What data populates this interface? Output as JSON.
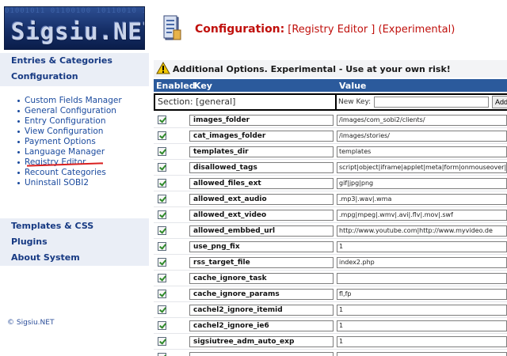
{
  "sidebar": {
    "logo_text": "Sigsiu.NET",
    "logo_watermark": "01001011 01100100 10110010 11001010 01101001 1010",
    "top_items": [
      {
        "label": "Entries & Categories"
      },
      {
        "label": "Configuration"
      }
    ],
    "submenu": [
      {
        "label": "Custom Fields Manager"
      },
      {
        "label": "General Configuration"
      },
      {
        "label": "Entry Configuration"
      },
      {
        "label": "View Configuration"
      },
      {
        "label": "Payment Options"
      },
      {
        "label": "Language Manager"
      },
      {
        "label": "Registry Editor"
      },
      {
        "label": "Recount Categories"
      },
      {
        "label": "Uninstall SOBI2"
      }
    ],
    "bottom_items": [
      {
        "label": "Templates & CSS"
      },
      {
        "label": "Plugins"
      },
      {
        "label": "About System"
      }
    ],
    "copyright": "© Sigsiu.NET"
  },
  "header": {
    "title_main": "Configuration:",
    "title_sub": "[Registry Editor ] (Experimental)"
  },
  "warning": {
    "text": "Additional Options. Experimental - Use at your own risk!"
  },
  "table": {
    "columns": {
      "enabled": "Enabled",
      "key": "Key",
      "value": "Value"
    },
    "section_label": "Section: [general]",
    "new_key_label": "New Key:",
    "new_key_value": "",
    "add_label": "Add",
    "rows": [
      {
        "key": "images_folder",
        "value": "/images/com_sobi2/clients/",
        "enabled": true
      },
      {
        "key": "cat_images_folder",
        "value": "/images/stories/",
        "enabled": true
      },
      {
        "key": "templates_dir",
        "value": "templates",
        "enabled": true
      },
      {
        "key": "disallowed_tags",
        "value": "script|object|iframe|applet|meta|form|onmouseover|onmo",
        "enabled": true
      },
      {
        "key": "allowed_files_ext",
        "value": "gif|jpg|png",
        "enabled": true
      },
      {
        "key": "allowed_ext_audio",
        "value": ".mp3|.wav|.wma",
        "enabled": true
      },
      {
        "key": "allowed_ext_video",
        "value": ".mpg|mpeg|.wmv|.avi|.flv|.mov|.swf",
        "enabled": true
      },
      {
        "key": "allowed_embbed_url",
        "value": "http://www.youtube.com|http://www.myvideo.de",
        "enabled": true
      },
      {
        "key": "use_png_fix",
        "value": "1",
        "enabled": true
      },
      {
        "key": "rss_target_file",
        "value": "index2.php",
        "enabled": true
      },
      {
        "key": "cache_ignore_task",
        "value": "",
        "enabled": true
      },
      {
        "key": "cache_ignore_params",
        "value": "fl,fp",
        "enabled": true
      },
      {
        "key": "cachel2_ignore_itemid",
        "value": "1",
        "enabled": true
      },
      {
        "key": "cachel2_ignore_ie6",
        "value": "1",
        "enabled": true
      },
      {
        "key": "sigsiutree_adm_auto_exp",
        "value": "1",
        "enabled": true
      },
      {
        "key": "",
        "value": "",
        "enabled": true
      }
    ]
  },
  "colors": {
    "accent_red": "#c0100c",
    "header_blue": "#2b5a9c",
    "nav_blue": "#173a83"
  }
}
